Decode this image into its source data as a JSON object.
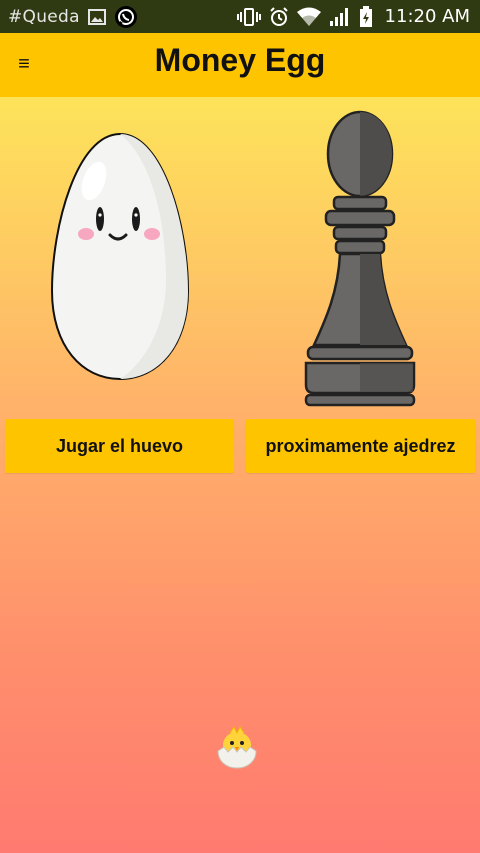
{
  "status_bar": {
    "notification_text": "#Queda",
    "time": "11:20 AM",
    "icons": [
      "image-icon",
      "whatsapp-icon",
      "vibrate-icon",
      "alarm-icon",
      "wifi-icon",
      "signal-icon",
      "battery-icon"
    ]
  },
  "app_bar": {
    "menu_icon": "≡",
    "title": "Money Egg"
  },
  "main": {
    "egg_button_label": "Jugar el huevo",
    "chess_button_label": "proximamente ajedrez"
  },
  "colors": {
    "accent": "#ffc400",
    "status_bar": "#2f3a12",
    "gradient_top": "#fde35a",
    "gradient_bottom": "#ff7a70"
  }
}
